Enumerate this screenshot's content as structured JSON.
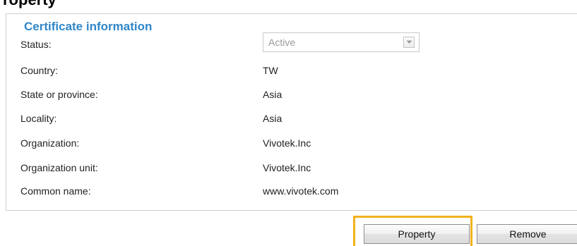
{
  "header": {
    "cut_title": "roperty"
  },
  "section": {
    "legend": "Certificate information"
  },
  "status": {
    "label": "Status:",
    "selected_value": "Active"
  },
  "fields": [
    {
      "label": "Country:",
      "value": "TW"
    },
    {
      "label": "State or province:",
      "value": "Asia"
    },
    {
      "label": "Locality:",
      "value": "Asia"
    },
    {
      "label": "Organization:",
      "value": "Vivotek.Inc"
    },
    {
      "label": "Organization unit:",
      "value": "Vivotek.Inc"
    },
    {
      "label": "Common name:",
      "value": "www.vivotek.com"
    }
  ],
  "buttons": {
    "property": "Property",
    "remove": "Remove"
  },
  "colors": {
    "legend_text": "#2e86c9",
    "highlight_border": "#f2b21c",
    "fieldset_border": "#cfcfcf"
  },
  "icons": {
    "dropdown": "chevron-down-icon"
  }
}
